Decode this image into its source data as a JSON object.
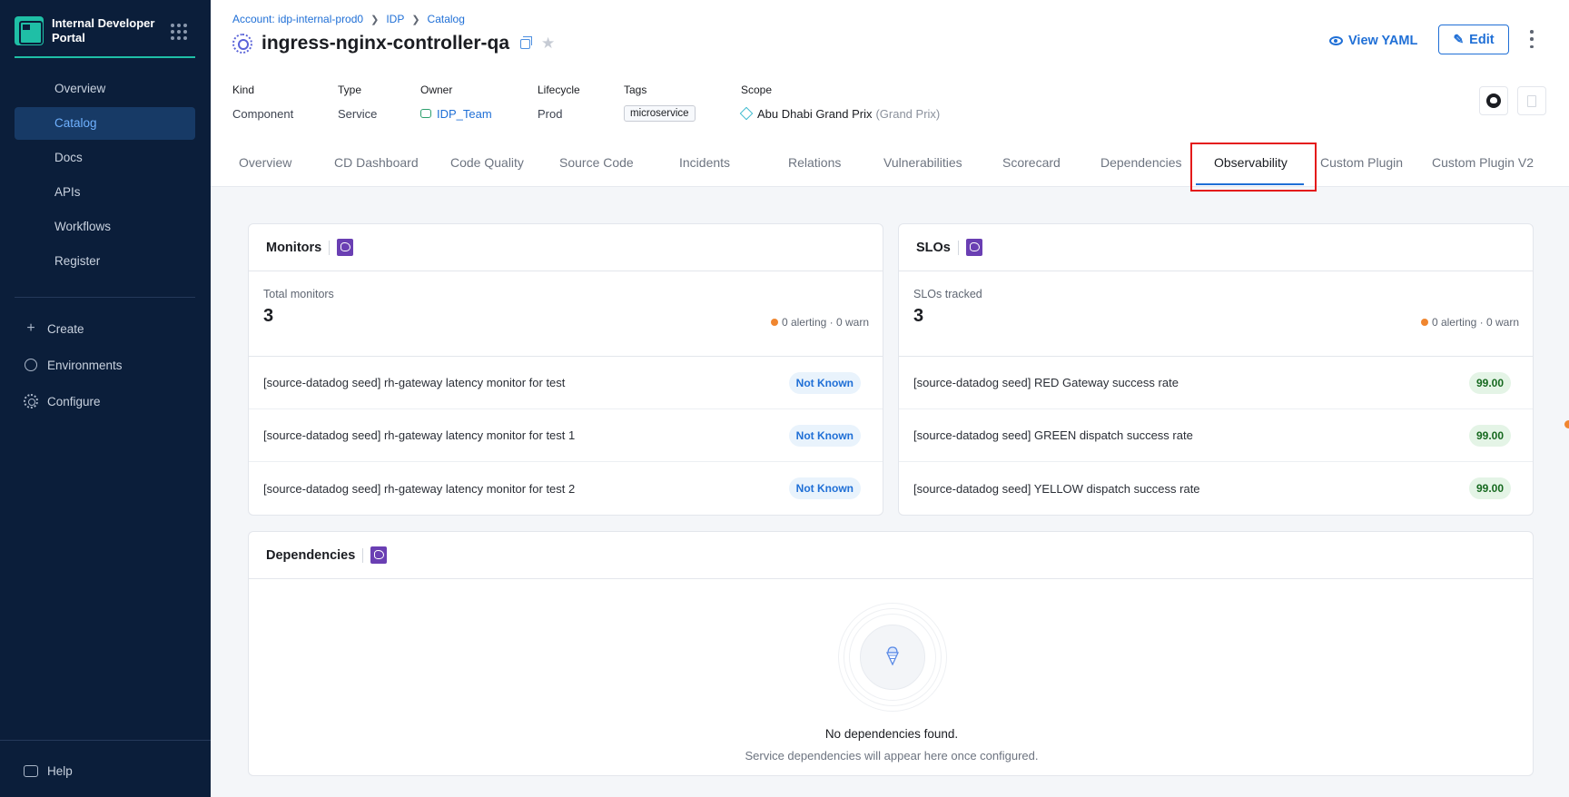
{
  "sidebar": {
    "brand_title": "Internal Developer Portal",
    "nav": [
      "Overview",
      "Catalog",
      "Docs",
      "APIs",
      "Workflows",
      "Register"
    ],
    "active_nav": "Catalog",
    "actions": [
      {
        "label": "Create",
        "icon": "plus-icon"
      },
      {
        "label": "Environments",
        "icon": "environments-icon"
      },
      {
        "label": "Configure",
        "icon": "gear-icon"
      }
    ],
    "help": "Help"
  },
  "breadcrumb": [
    "Account: idp-internal-prod0",
    "IDP",
    "Catalog"
  ],
  "entity": {
    "title": "ingress-nginx-controller-qa"
  },
  "header_actions": {
    "view_yaml": "View YAML",
    "edit": "Edit"
  },
  "meta": {
    "kind_label": "Kind",
    "kind": "Component",
    "type_label": "Type",
    "type": "Service",
    "owner_label": "Owner",
    "owner": "IDP_Team",
    "lifecycle_label": "Lifecycle",
    "lifecycle": "Prod",
    "tags_label": "Tags",
    "tag": "microservice",
    "scope_label": "Scope",
    "scope": "Abu Dhabi Grand Prix",
    "scope_suffix": "(Grand Prix)"
  },
  "tabs": [
    "Overview",
    "CD Dashboard",
    "Code Quality",
    "Source Code",
    "Incidents",
    "Relations",
    "Vulnerabilities",
    "Scorecard",
    "Dependencies",
    "Observability",
    "Custom Plugin",
    "Custom Plugin V2"
  ],
  "active_tab": "Observability",
  "monitors": {
    "title": "Monitors",
    "summary_label": "Total monitors",
    "total": "3",
    "status": "0 alerting · 0 warn",
    "rows": [
      {
        "name": "[source-datadog seed] rh-gateway latency monitor for test",
        "status": "Not Known"
      },
      {
        "name": "[source-datadog seed] rh-gateway latency monitor for test 1",
        "status": "Not Known"
      },
      {
        "name": "[source-datadog seed] rh-gateway latency monitor for test 2",
        "status": "Not Known"
      }
    ]
  },
  "slos": {
    "title": "SLOs",
    "summary_label": "SLOs tracked",
    "total": "3",
    "status": "0 alerting · 0 warn",
    "rows": [
      {
        "name": "[source-datadog seed] RED Gateway success rate",
        "value": "99.00"
      },
      {
        "name": "[source-datadog seed] GREEN dispatch success rate",
        "value": "99.00"
      },
      {
        "name": "[source-datadog seed] YELLOW dispatch success rate",
        "value": "99.00"
      }
    ]
  },
  "dependencies": {
    "title": "Dependencies",
    "empty_title": "No dependencies found.",
    "empty_sub": "Service dependencies will appear here once configured."
  },
  "colors": {
    "sidebar_bg": "#0b1e3a",
    "accent": "#1f6fd6",
    "brand": "#1fbfa6",
    "alert_dot": "#f0862f",
    "highlight": "#e41a1a"
  }
}
